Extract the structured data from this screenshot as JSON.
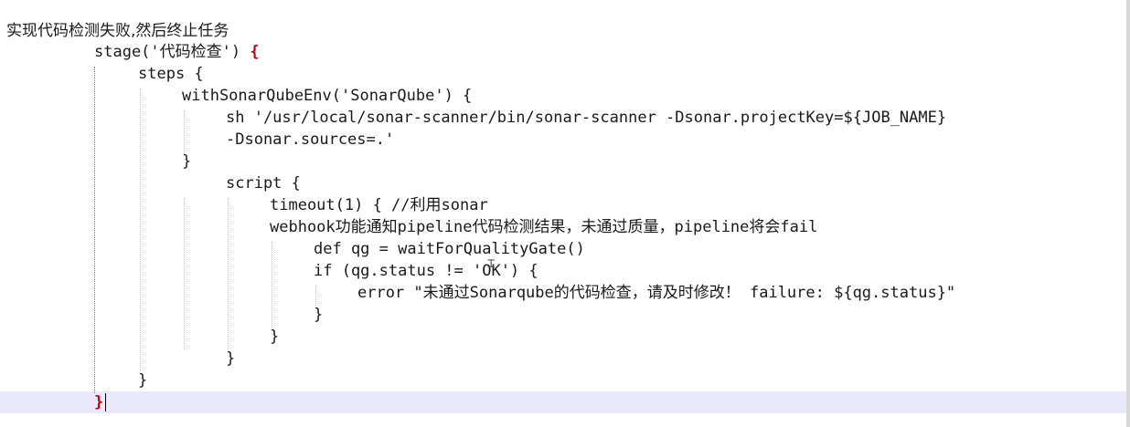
{
  "heading": "实现代码检测失败,然后终止任务",
  "editor": {
    "accent_colors": {
      "brace_match": "#d40000",
      "current_line": "#e9e9fb"
    },
    "lines": [
      {
        "id": "l1",
        "text": "stage('代码检查') "
      },
      {
        "id": "l1b",
        "text": "{"
      },
      {
        "id": "l2",
        "text": "steps {"
      },
      {
        "id": "l3",
        "text": "withSonarQubeEnv('SonarQube') {"
      },
      {
        "id": "l4",
        "text": "sh '/usr/local/sonar-scanner/bin/sonar-scanner -Dsonar.projectKey=${JOB_NAME}"
      },
      {
        "id": "l5",
        "text": "-Dsonar.sources=.'"
      },
      {
        "id": "l6",
        "text": "}"
      },
      {
        "id": "l7",
        "text": "script {"
      },
      {
        "id": "l8",
        "text": "timeout(1) { //利用sonar"
      },
      {
        "id": "l9",
        "text": "webhook功能通知pipeline代码检测结果，未通过质量，pipeline将会fail"
      },
      {
        "id": "l10",
        "text": "def qg = waitForQualityGate()"
      },
      {
        "id": "l11",
        "text": "if (qg.status != 'OK') {"
      },
      {
        "id": "l12",
        "text": "error \"未通过Sonarqube的代码检查，请及时修改！ failure: ${qg.status}\""
      },
      {
        "id": "l13",
        "text": "}"
      },
      {
        "id": "l14",
        "text": "}"
      },
      {
        "id": "l15",
        "text": "}"
      },
      {
        "id": "l16",
        "text": "}"
      },
      {
        "id": "l17",
        "text": "}"
      }
    ]
  }
}
